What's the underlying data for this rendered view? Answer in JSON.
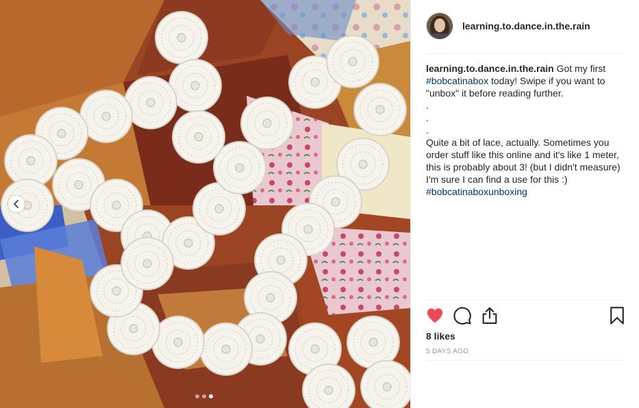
{
  "post": {
    "username": "learning.to.dance.in.the.rain",
    "caption": {
      "username": "learning.to.dance.in.the.rain",
      "text_1": " Got my first ",
      "hashtag_1": "#bobcatinabox",
      "text_2": " today! Swipe if you want to \"unbox\" it before reading further.",
      "dot_lines": [
        ".",
        ".",
        "."
      ],
      "text_3": "Quite a bit of lace, actually. Sometimes you order stuff like this online and it's like 1 meter, this is probably about 3! (but I didn't measure) I'm sure I can find a use for this :)",
      "hashtag_2": "#bobcatinaboxunboxing"
    },
    "likes": "8 likes",
    "timestamp": "5 DAYS AGO",
    "carousel": {
      "count": 3,
      "active_index": 2
    }
  },
  "icons": {
    "like": "heart-icon",
    "comment": "comment-icon",
    "share": "share-icon",
    "save": "bookmark-icon",
    "prev": "chevron-left-icon"
  },
  "colors": {
    "like_active": "#ed4956",
    "hashtag": "#003569",
    "muted": "#999999",
    "text": "#262626"
  }
}
